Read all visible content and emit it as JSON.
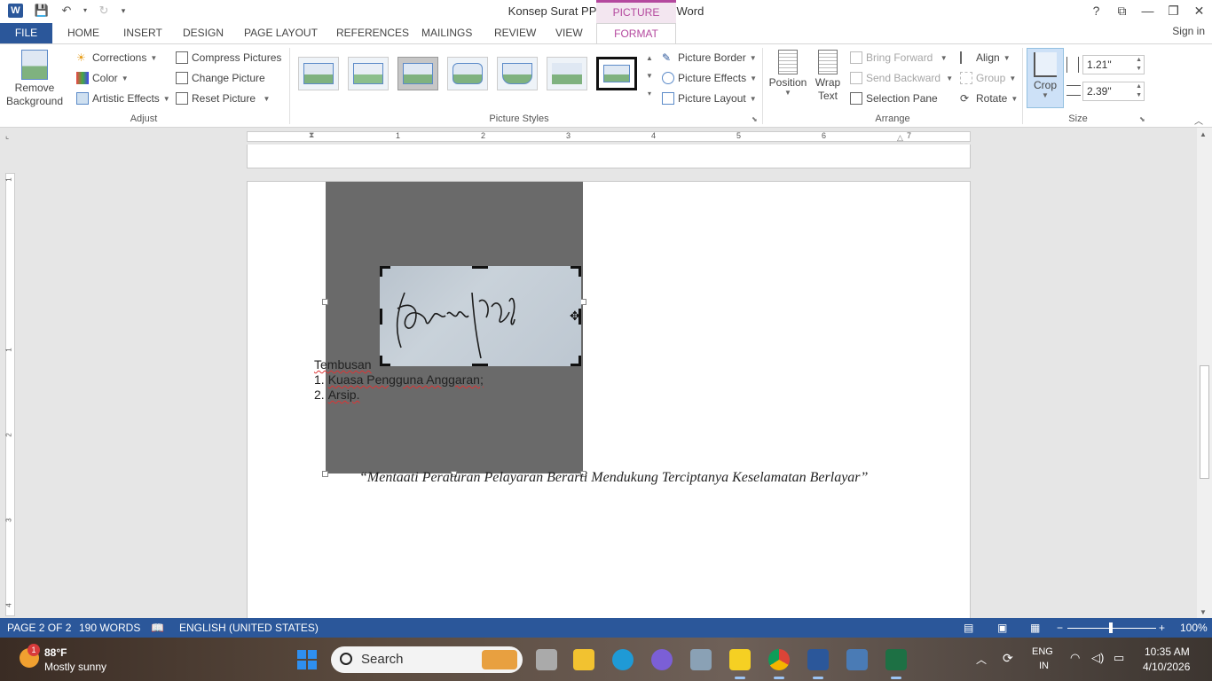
{
  "window": {
    "title": "Konsep Surat PPK ke PP Final - Word",
    "contextual_label": "PICTURE TOOLS",
    "controls": [
      "?",
      "⧉",
      "—",
      "❐",
      "✕"
    ]
  },
  "tabs": [
    "FILE",
    "HOME",
    "INSERT",
    "DESIGN",
    "PAGE LAYOUT",
    "REFERENCES",
    "MAILINGS",
    "REVIEW",
    "VIEW",
    "FORMAT"
  ],
  "sign_in": "Sign in",
  "ribbon": {
    "adjust": {
      "label": "Adjust",
      "remove_background": "Remove Background",
      "corrections": "Corrections",
      "color": "Color",
      "artistic_effects": "Artistic Effects",
      "compress_pictures": "Compress Pictures",
      "change_picture": "Change Picture",
      "reset_picture": "Reset Picture"
    },
    "picture_styles": {
      "label": "Picture Styles",
      "picture_border": "Picture Border",
      "picture_effects": "Picture Effects",
      "picture_layout": "Picture Layout"
    },
    "arrange": {
      "label": "Arrange",
      "position": "Position",
      "wrap_text": "Wrap Text",
      "bring_forward": "Bring Forward",
      "send_backward": "Send Backward",
      "selection_pane": "Selection Pane",
      "align": "Align",
      "group": "Group",
      "rotate": "Rotate"
    },
    "size": {
      "label": "Size",
      "crop": "Crop",
      "height": "1.21\"",
      "width": "2.39\""
    }
  },
  "ruler": {
    "h_numbers": [
      "1",
      "2",
      "3",
      "4",
      "5",
      "6",
      "7"
    ],
    "v_numbers": [
      "1",
      "1",
      "2",
      "3",
      "4"
    ]
  },
  "document": {
    "tembusan_heading": "Tembusan",
    "tembusan_items": [
      {
        "num": "1.",
        "text": "Kuasa Pengguna Anggaran;"
      },
      {
        "num": "2.",
        "text": "Arsip."
      }
    ],
    "motto": "“Mentaati Peraturan Pelayaran Berarti Mendukung Terciptanya Keselamatan Berlayar”"
  },
  "status": {
    "page": "PAGE 2 OF 2",
    "words": "190 WORDS",
    "language": "ENGLISH (UNITED STATES)",
    "zoom": "100%",
    "zoom_minus": "−",
    "zoom_plus": "+"
  },
  "taskbar": {
    "weather_temp": "88°F",
    "weather_desc": "Mostly sunny",
    "weather_badge": "1",
    "search_placeholder": "Search",
    "lang_top": "ENG",
    "lang_bottom": "IN",
    "time": "10:35 AM",
    "date": "4/10/2026"
  },
  "colors": {
    "word_blue": "#2b579a",
    "picture_tools_accent": "#b4489e"
  }
}
